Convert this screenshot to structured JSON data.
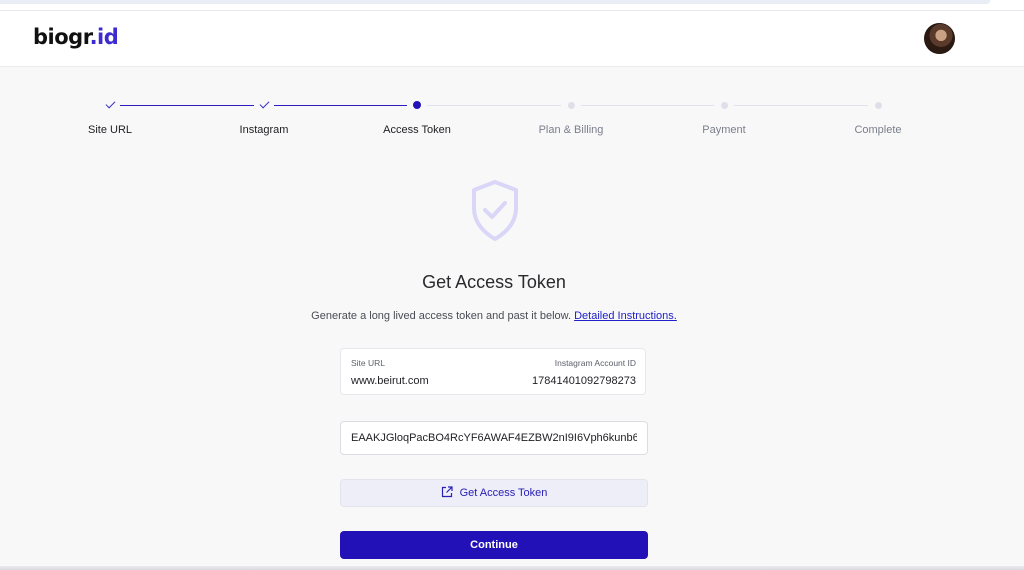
{
  "brand": {
    "name_prefix": "biogr",
    "name_dot": ".",
    "name_suffix": "id",
    "accent_color": "#2311b8"
  },
  "header": {
    "avatar": "user-avatar"
  },
  "stepper": {
    "steps": [
      {
        "label": "Site URL",
        "state": "done"
      },
      {
        "label": "Instagram",
        "state": "done"
      },
      {
        "label": "Access Token",
        "state": "current"
      },
      {
        "label": "Plan & Billing",
        "state": "pending"
      },
      {
        "label": "Payment",
        "state": "pending"
      },
      {
        "label": "Complete",
        "state": "pending"
      }
    ]
  },
  "main": {
    "icon": "shield-check-icon",
    "title": "Get Access Token",
    "subtitle": "Generate a long lived access token and past it below.",
    "instructions_link": "Detailed Instructions.",
    "info": {
      "site_url_label": "Site URL",
      "site_url_value": "www.beirut.com",
      "account_id_label": "Instagram Account ID",
      "account_id_value": "17841401092798273"
    },
    "token_value": "EAAKJGloqPacBO4RcYF6AWAF4EZBW2nI9I6Vph6kunb6",
    "get_token_label": "Get Access Token",
    "continue_label": "Continue"
  }
}
